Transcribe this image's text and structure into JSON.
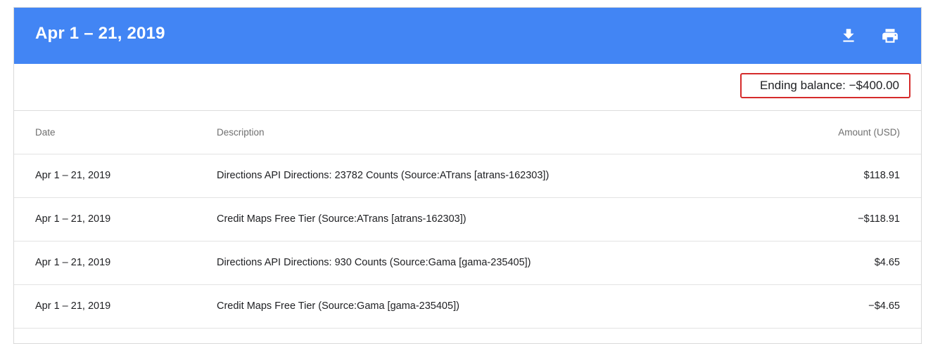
{
  "header": {
    "title": "Apr 1 – 21, 2019",
    "download_icon": "download-icon",
    "print_icon": "print-icon",
    "color": "#4285f4"
  },
  "balance": {
    "label": "Ending balance: −$400.00",
    "highlight_color": "#d52b2b"
  },
  "table": {
    "columns": {
      "date": "Date",
      "description": "Description",
      "amount": "Amount (USD)"
    },
    "rows": [
      {
        "date": "Apr 1 – 21, 2019",
        "description": "Directions API Directions: 23782 Counts (Source:ATrans [atrans-162303])",
        "amount": "$118.91"
      },
      {
        "date": "Apr 1 – 21, 2019",
        "description": "Credit Maps Free Tier (Source:ATrans [atrans-162303])",
        "amount": "−$118.91"
      },
      {
        "date": "Apr 1 – 21, 2019",
        "description": "Directions API Directions: 930 Counts (Source:Gama [gama-235405])",
        "amount": "$4.65"
      },
      {
        "date": "Apr 1 – 21, 2019",
        "description": "Credit Maps Free Tier (Source:Gama [gama-235405])",
        "amount": "−$4.65"
      }
    ]
  }
}
